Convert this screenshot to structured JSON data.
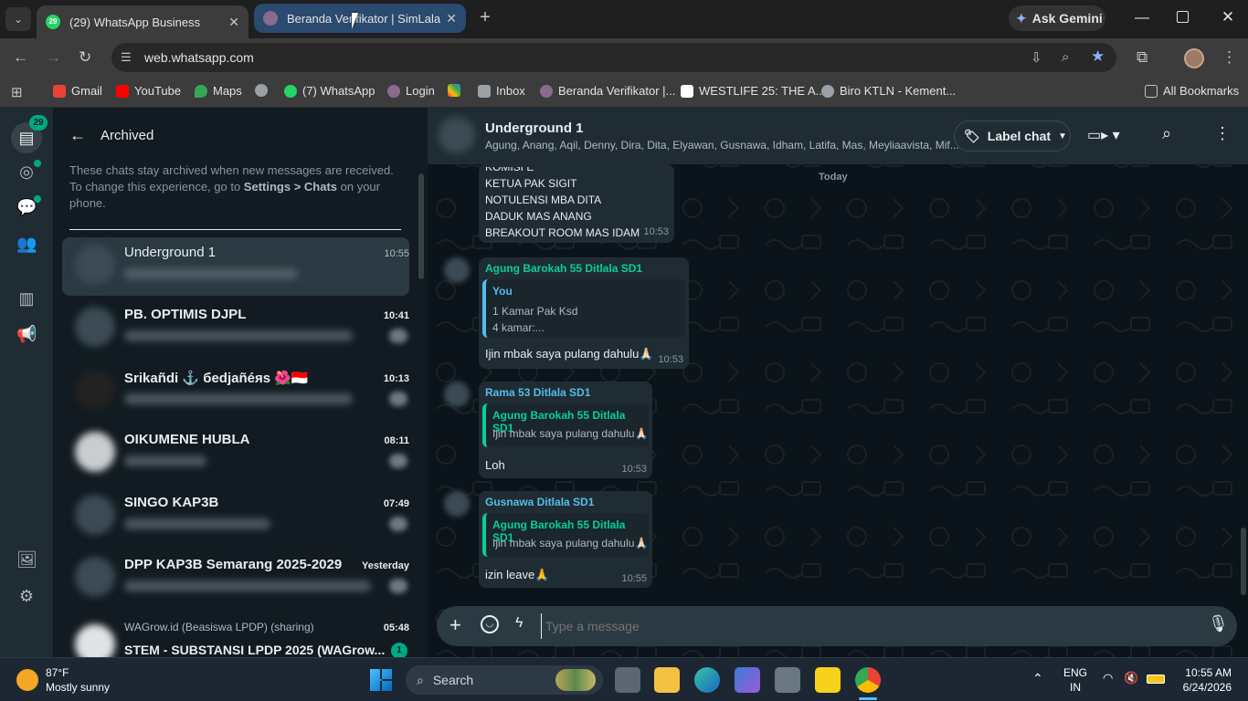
{
  "browser": {
    "tabs": [
      {
        "title": "(29) WhatsApp Business",
        "badge": "29"
      },
      {
        "title": "Beranda Verifikator | SimLala"
      }
    ],
    "ask_gemini": "Ask Gemini",
    "url": "web.whatsapp.com",
    "bookmarks": [
      "Gmail",
      "YouTube",
      "Maps",
      "(7) WhatsApp",
      "Login",
      "Inbox",
      "Beranda Verifikator |...",
      "WESTLIFE 25: THE A...",
      "Biro KTLN - Kement..."
    ],
    "bookmarks_badge": "29",
    "all_bookmarks": "All Bookmarks"
  },
  "rail": {
    "chats_badge": "29"
  },
  "sidebar": {
    "title": "Archived",
    "info_pre": "These chats stay archived when new messages are received. To change this experience, go to ",
    "info_bold": "Settings > Chats",
    "info_post": " on your phone.",
    "chats": [
      {
        "name": "Underground 1",
        "time": "10:55"
      },
      {
        "name": "PB. OPTIMIS DJPL",
        "time": "10:41"
      },
      {
        "name": "Srikañdi ⚓ бedjañéяs 🌺🇮🇩",
        "time": "10:13"
      },
      {
        "name": "OIKUMENE HUBLA",
        "time": "08:11"
      },
      {
        "name": "SINGO KAP3B",
        "time": "07:49"
      },
      {
        "name": "DPP KAP3B Semarang 2025-2029",
        "time": "Yesterday"
      },
      {
        "name": "STEM - SUBSTANSI LPDP 2025 (WAGrow...",
        "group": "WAGrow.id (Beasiswa LPDP) (sharing)",
        "time": "05:48",
        "unread": "1"
      }
    ]
  },
  "chat": {
    "title": "Underground 1",
    "members": "Agung, Anang, Aqil, Denny, Dira, Dita, Elyawan, Gusnawa, Idham, Latifa, Mas, Meyliaavista, Mif...",
    "label_chat": "Label chat",
    "day": "Today",
    "msg1": {
      "lines": [
        "KOMISI E",
        "KETUA PAK SIGIT",
        "NOTULENSI MBA DITA",
        "DADUK MAS ANANG",
        "BREAKOUT ROOM MAS IDAM"
      ],
      "time": "10:53"
    },
    "msg2": {
      "sender": "Agung Barokah 55 Ditlala SD1",
      "quote_author": "You",
      "quote_lines": [
        "1 Kamar Pak Ksd",
        "4 kamar:..."
      ],
      "text": "Ijin mbak saya pulang dahulu🙏🏻",
      "time": "10:53"
    },
    "msg3": {
      "sender": "Rama 53 Ditlala SD1",
      "quote_author": "Agung Barokah 55 Ditlala SD1",
      "quote_text": "Ijin mbak saya pulang dahulu🙏🏻",
      "text": "Loh",
      "time": "10:53"
    },
    "msg4": {
      "sender": "Gusnawa Ditlala SD1",
      "quote_author": "Agung Barokah 55 Ditlala SD1",
      "quote_text": "Ijin mbak saya pulang dahulu🙏🏻",
      "text": "izin leave🙏",
      "time": "10:55"
    },
    "placeholder": "Type a message"
  },
  "taskbar": {
    "weather_temp": "87°F",
    "weather_desc": "Mostly sunny",
    "search": "Search",
    "lang1": "ENG",
    "lang2": "IN",
    "time": "10:55 AM",
    "date": "6/24/2026"
  },
  "colors": {
    "accent": "#00a884",
    "sender_green": "#53bdeb",
    "quote_green": "#06cf9c"
  }
}
